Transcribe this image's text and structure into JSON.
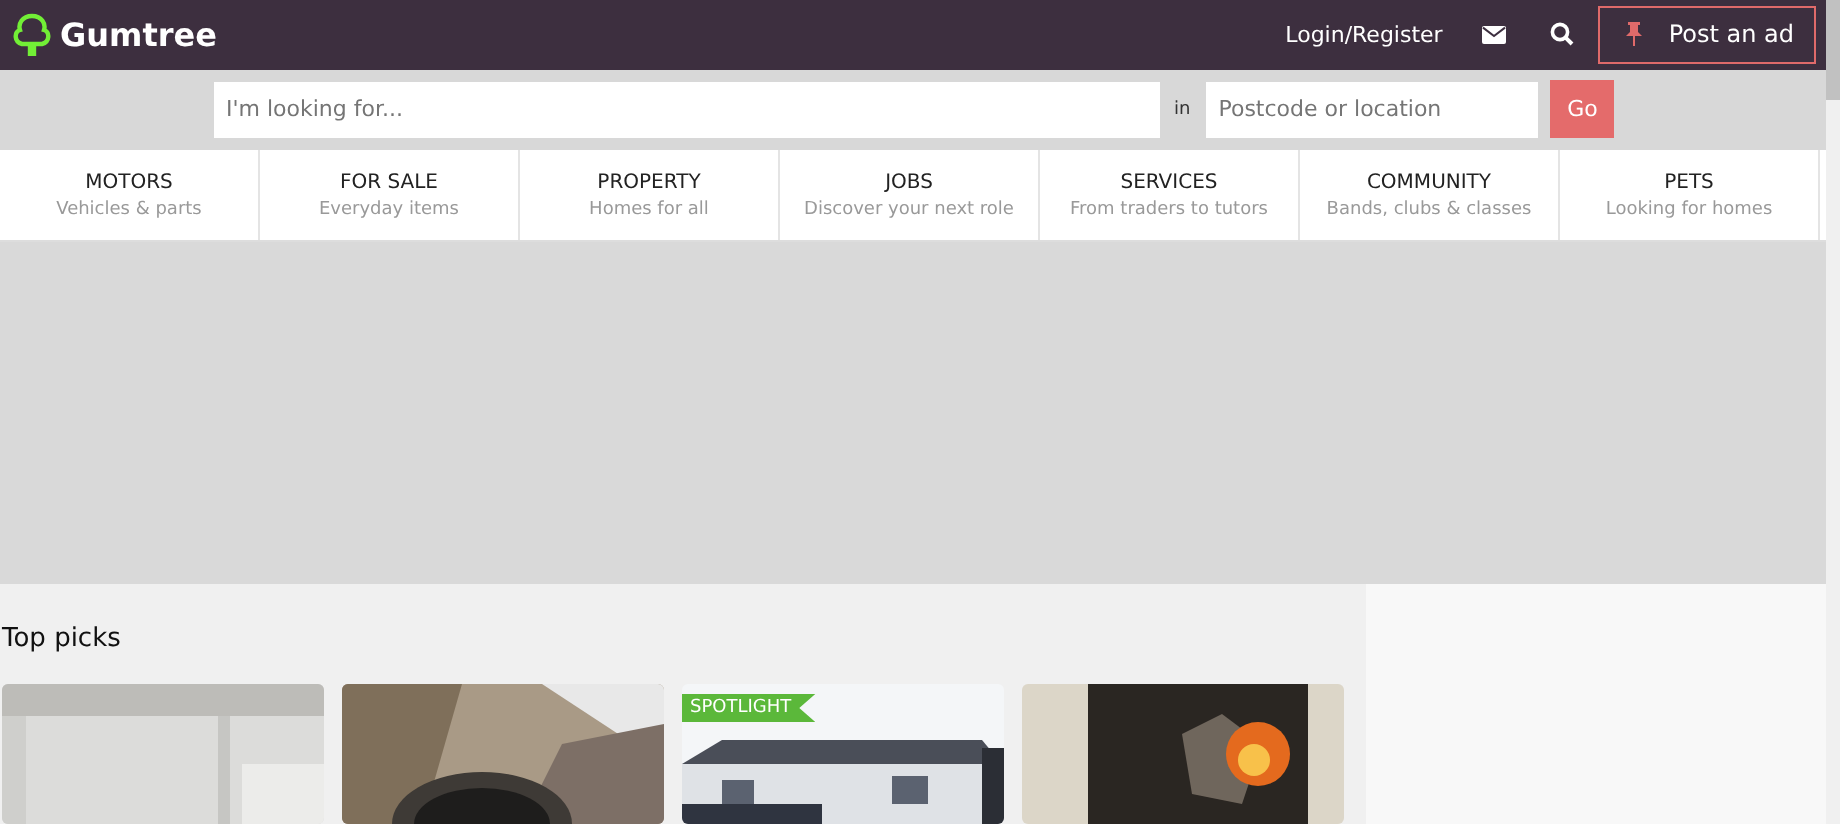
{
  "header": {
    "logo": "Gumtree",
    "login": "Login/Register",
    "post_button": "Post an ad"
  },
  "search": {
    "placeholder": "I'm looking for...",
    "in_label": "in",
    "location_placeholder": "Postcode or location",
    "go_button": "Go"
  },
  "categories": [
    {
      "title": "MOTORS",
      "subtitle": "Vehicles & parts"
    },
    {
      "title": "FOR SALE",
      "subtitle": "Everyday items"
    },
    {
      "title": "PROPERTY",
      "subtitle": "Homes for all"
    },
    {
      "title": "JOBS",
      "subtitle": "Discover your next role"
    },
    {
      "title": "SERVICES",
      "subtitle": "From traders to tutors"
    },
    {
      "title": "COMMUNITY",
      "subtitle": "Bands, clubs & classes"
    },
    {
      "title": "PETS",
      "subtitle": "Looking for homes"
    }
  ],
  "top_picks": {
    "heading": "Top picks",
    "items": [
      {
        "kind": "picture"
      },
      {
        "kind": "picture"
      },
      {
        "kind": "picture",
        "badge": "SPOTLIGHT"
      },
      {
        "kind": "picture"
      }
    ]
  }
}
